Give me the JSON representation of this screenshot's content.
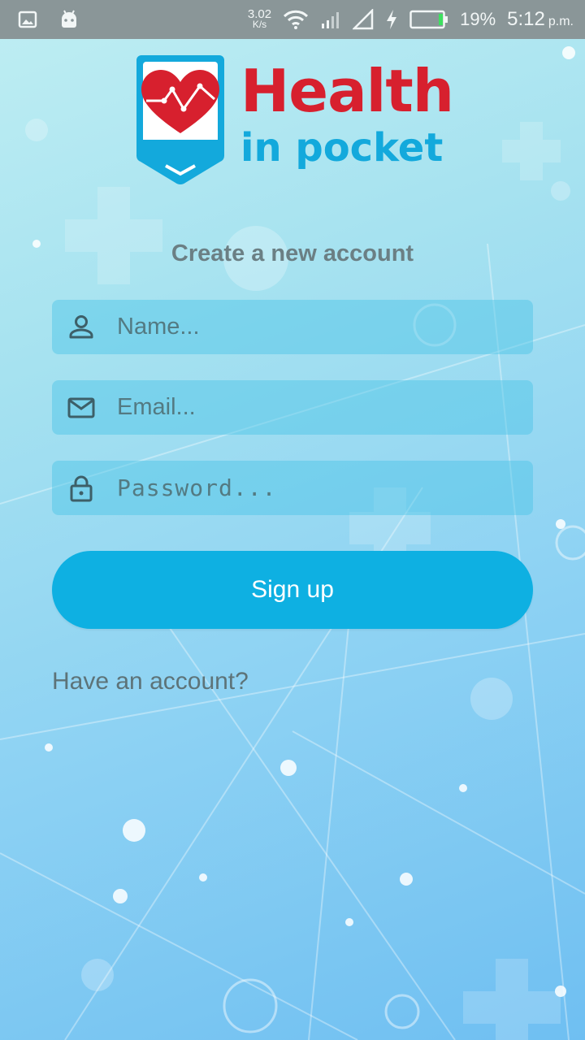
{
  "status_bar": {
    "speed_value": "3.02",
    "speed_unit": "K/s",
    "battery_percent": "19%",
    "time": "5:12",
    "ampm": "p.m."
  },
  "logo": {
    "title": "Health",
    "subtitle": "in pocket"
  },
  "form": {
    "heading": "Create a new account",
    "name_placeholder": "Name...",
    "email_placeholder": "Email...",
    "password_placeholder": "Password...",
    "signup_label": "Sign up",
    "login_link": "Have an account?"
  },
  "colors": {
    "brand_red": "#d7202e",
    "brand_blue": "#13a9dc",
    "button": "#0eb0e2"
  }
}
